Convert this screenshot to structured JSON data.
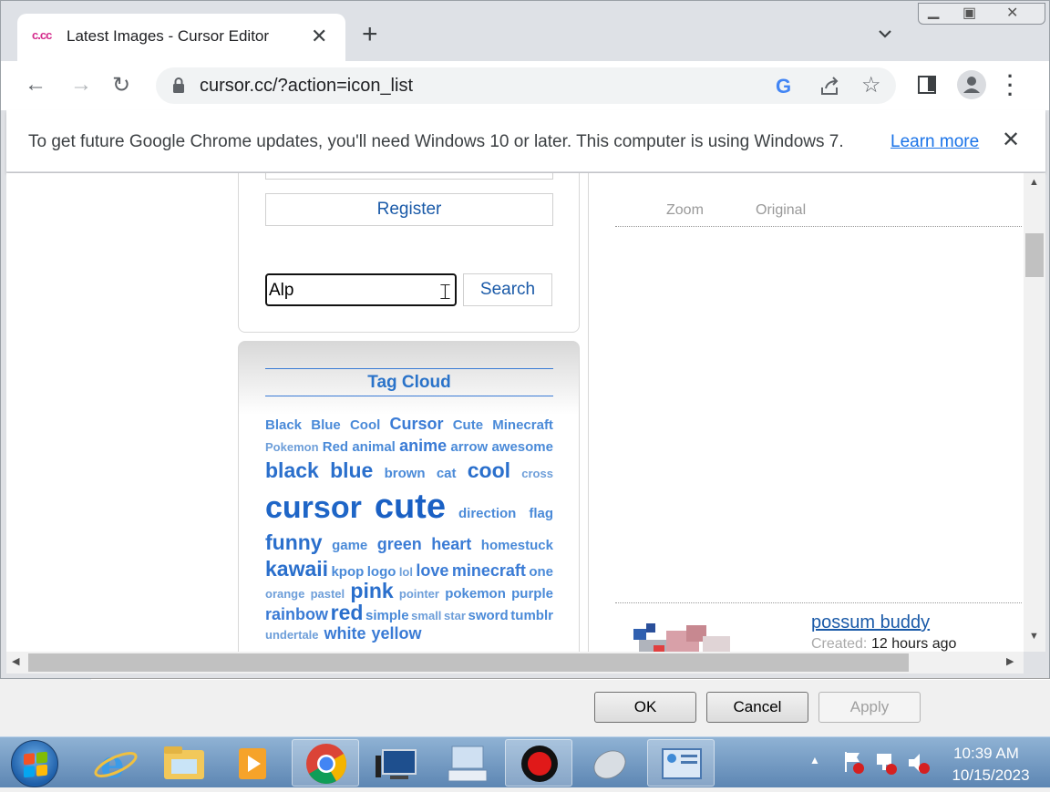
{
  "tab": {
    "favicon_text": "c.cc",
    "title": "Latest Images - Cursor Editor",
    "close": "✕"
  },
  "newtab": "+",
  "address": {
    "url": "cursor.cc/?action=icon_list",
    "google": "G"
  },
  "infobar": {
    "message": "To get future Google Chrome updates, you'll need Windows 10 or later. This computer is using Windows 7.",
    "link": "Learn more",
    "close": "✕"
  },
  "sidebar": {
    "register_label": "Register",
    "search_value": "Alp",
    "search_button": "Search",
    "tag_cloud_title": "Tag Cloud",
    "tags": [
      [
        [
          "Black",
          2
        ],
        [
          "Blue",
          2
        ],
        [
          "Cool",
          2
        ],
        [
          "Cursor",
          3
        ],
        [
          "Cute",
          2
        ],
        [
          "Minecraft",
          2
        ]
      ],
      [
        [
          "Pokemon",
          1
        ],
        [
          "Red",
          2
        ],
        [
          "animal",
          2
        ],
        [
          "anime",
          3
        ],
        [
          "arrow",
          2
        ],
        [
          "awesome",
          2
        ]
      ],
      [
        [
          "black",
          4
        ],
        [
          "blue",
          4
        ],
        [
          "brown",
          2
        ],
        [
          "cat",
          2
        ],
        [
          "cool",
          4
        ],
        [
          "cross",
          1
        ]
      ],
      [
        [
          "cursor",
          5
        ],
        [
          "cute",
          6
        ],
        [
          "direction",
          2
        ],
        [
          "flag",
          2
        ]
      ],
      [
        [
          "funny",
          4
        ],
        [
          "game",
          2
        ],
        [
          "green",
          3
        ],
        [
          "heart",
          3
        ],
        [
          "homestuck",
          2
        ]
      ],
      [
        [
          "kawaii",
          4
        ],
        [
          "kpop",
          2
        ],
        [
          "logo",
          2
        ],
        [
          "lol",
          1
        ],
        [
          "love",
          3
        ],
        [
          "minecraft",
          3
        ],
        [
          "one",
          2
        ]
      ],
      [
        [
          "orange",
          1
        ],
        [
          "pastel",
          1
        ],
        [
          "pink",
          4
        ],
        [
          "pointer",
          1
        ],
        [
          "pokemon",
          2
        ],
        [
          "purple",
          2
        ]
      ],
      [
        [
          "rainbow",
          3
        ],
        [
          "red",
          4
        ],
        [
          "simple",
          2
        ],
        [
          "small",
          1
        ],
        [
          "star",
          1
        ],
        [
          "sword",
          2
        ],
        [
          "tumblr",
          2
        ]
      ],
      [
        [
          "undertale",
          1
        ],
        [
          "white",
          3
        ],
        [
          "yellow",
          3
        ]
      ]
    ]
  },
  "main": {
    "zoom_label": "Zoom",
    "original_label": "Original",
    "item_title": "possum buddy",
    "created_label": "Created:",
    "created_value": "12 hours ago"
  },
  "dialog": {
    "ok": "OK",
    "cancel": "Cancel",
    "apply": "Apply"
  },
  "taskbar": {
    "time": "10:39 AM",
    "date": "10/15/2023"
  },
  "colors": {
    "link": "#1a5aa8",
    "tag": "#2a6fcc",
    "chrome_bg": "#dee1e6",
    "taskbar": "#5d86b3"
  }
}
